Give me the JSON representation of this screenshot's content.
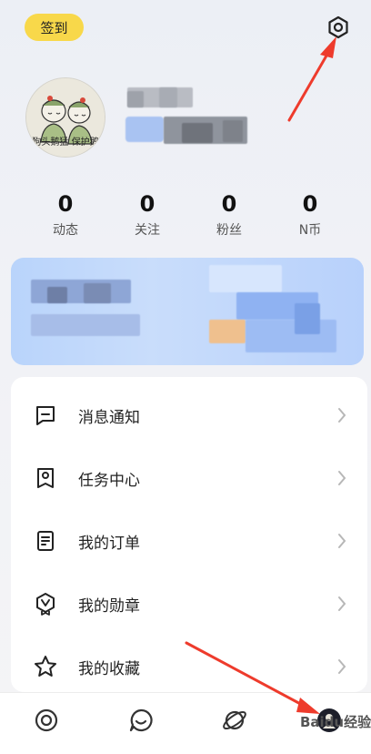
{
  "header": {
    "signin_label": "签到",
    "settings_icon": "gear-icon"
  },
  "profile": {
    "avatar_caption": "狗头鹅猛 保护鹅"
  },
  "stats": [
    {
      "value": "0",
      "label": "动态"
    },
    {
      "value": "0",
      "label": "关注"
    },
    {
      "value": "0",
      "label": "粉丝"
    },
    {
      "value": "0",
      "label": "N币"
    }
  ],
  "menu": [
    {
      "label": "消息通知",
      "icon": "message-icon"
    },
    {
      "label": "任务中心",
      "icon": "task-icon"
    },
    {
      "label": "我的订单",
      "icon": "order-icon"
    },
    {
      "label": "我的勋章",
      "icon": "badge-icon"
    },
    {
      "label": "我的收藏",
      "icon": "star-icon"
    }
  ],
  "bottom_nav": [
    {
      "icon": "home-icon"
    },
    {
      "icon": "chat-icon"
    },
    {
      "icon": "planet-icon"
    },
    {
      "icon": "profile-avatar-icon"
    }
  ],
  "watermark": "Baidu经验",
  "colors": {
    "accent_yellow": "#f8d84a",
    "banner_blue": "#b9d4fb",
    "arrow_red": "#ee3b2c"
  }
}
